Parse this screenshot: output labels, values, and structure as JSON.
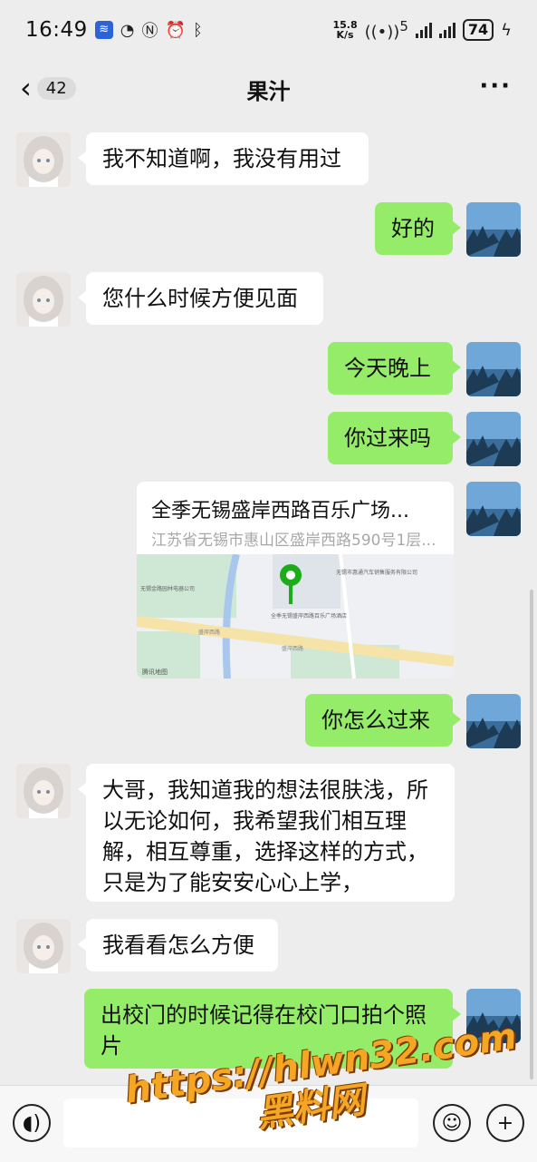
{
  "status_bar": {
    "time": "16:49",
    "net_speed_value": "15.8",
    "net_speed_unit": "K/s",
    "hotspot_badge": "5",
    "battery": "74"
  },
  "header": {
    "back_count": "42",
    "title": "果汁",
    "more_label": "···"
  },
  "messages": [
    {
      "side": "in",
      "text": "我不知道啊，我没有用过"
    },
    {
      "side": "out",
      "text": "好的"
    },
    {
      "side": "in",
      "text": "您什么时候方便见面"
    },
    {
      "side": "out",
      "text": "今天晚上"
    },
    {
      "side": "out",
      "text": "你过来吗"
    },
    {
      "side": "out",
      "type": "location",
      "name": "全季无锡盛岸西路百乐广场...",
      "address": "江苏省无锡市惠山区盛岸西路590号1层..."
    },
    {
      "side": "out",
      "text": "你怎么过来"
    },
    {
      "side": "in",
      "text": "大哥，我知道我的想法很肤浅，所以无论如何，我希望我们相互理解，相互尊重，选择这样的方式，只是为了能安安心心上学，"
    },
    {
      "side": "in",
      "text": "我看看怎么方便"
    },
    {
      "side": "out",
      "text": "出校门的时候记得在校门口拍个照片"
    }
  ],
  "map": {
    "label_top_right": "无锡市惠通汽车销售服务有限公司",
    "label_left": "无锡金路园林电器公司",
    "label_hotel": "全季无锡盛岸西路百乐广场酒店",
    "label_road_1": "盛岸西路",
    "label_road_2": "盛岸西路",
    "label_credit": "腾讯地图",
    "marker_color": "#1aad19"
  },
  "input_bar": {
    "voice_icon": "voice-icon",
    "emoji_icon": "emoji-icon",
    "plus_icon": "plus-icon"
  },
  "watermark": {
    "url": "https://hlwn32.com",
    "name": "黑料网"
  },
  "colors": {
    "outgoing_bubble": "#95ec69",
    "incoming_bubble": "#ffffff",
    "background": "#ededed"
  }
}
